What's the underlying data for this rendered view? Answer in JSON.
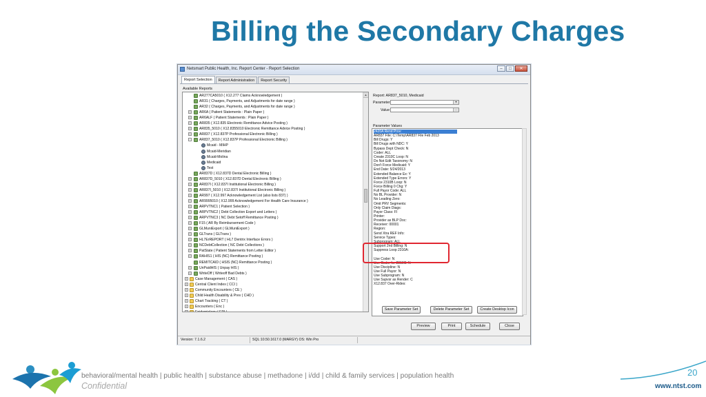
{
  "slide": {
    "title": "Billing the Secondary Charges",
    "tagline": "behavioral/mental health | public health | substance abuse | methadone | i/dd | child & family services | population health",
    "confidential": "Confidential",
    "page_number": "20",
    "url": "www.ntst.com"
  },
  "window": {
    "title": "Netsmart Public Health, Inc. Report Center - Report Selection",
    "controls": [
      "–",
      "□",
      "✕"
    ]
  },
  "tabs": [
    "Report Selection",
    "Report Administration",
    "Report Security"
  ],
  "available_reports_label": "Available Reports",
  "tree": [
    {
      "text": "AR277CA5010 ( X12.277 Claims Acknowledgement )",
      "level": 1,
      "icon": "report"
    },
    {
      "text": "AR31 ( Charges, Payments, and Adjustments for date range )",
      "level": 1,
      "icon": "report"
    },
    {
      "text": "AR32 ( Charges, Payments, and Adjustments for date range )",
      "level": 1,
      "icon": "report"
    },
    {
      "text": "AR6A ( Patient Statements : Plain Paper )",
      "level": 1,
      "icon": "report",
      "exp": "+"
    },
    {
      "text": "AR6ALF ( Patient Statements : Plain Paper )",
      "level": 1,
      "icon": "report",
      "exp": "+"
    },
    {
      "text": "AR835 ( X12.835 Electronic Remittance Advice Posting )",
      "level": 1,
      "icon": "report",
      "exp": "+"
    },
    {
      "text": "AR835_5010 ( X12.8355010 Electronic Remittance Advice Posting )",
      "level": 1,
      "icon": "report",
      "exp": "+"
    },
    {
      "text": "AR837 ( X12.837P Professional Electronic Billing )",
      "level": 1,
      "icon": "report",
      "exp": "+"
    },
    {
      "text": "AR837_5010 ( X12.837P Professional Electronic Billing )",
      "level": 1,
      "icon": "report",
      "exp": "-"
    },
    {
      "text": "Mcaid - MIHP",
      "level": 2,
      "icon": "user"
    },
    {
      "text": "Mcaid-Meridian",
      "level": 2,
      "icon": "user"
    },
    {
      "text": "Mcaid-Molina",
      "level": 2,
      "icon": "user"
    },
    {
      "text": "Medicaid",
      "level": 2,
      "icon": "user"
    },
    {
      "text": "Test",
      "level": 2,
      "icon": "user"
    },
    {
      "text": "AR837D ( X12.837D Dental Electronic Billing )",
      "level": 1,
      "icon": "report"
    },
    {
      "text": "AR837D_5010 ( X12.837D Dental Electronic Billing )",
      "level": 1,
      "icon": "report",
      "exp": "+"
    },
    {
      "text": "AR837I ( X12.837I Institutional Electronic Billing )",
      "level": 1,
      "icon": "report",
      "exp": "+"
    },
    {
      "text": "AR837I_5010 ( X12.837I Institutional Electronic Billing )",
      "level": 1,
      "icon": "report",
      "exp": "+"
    },
    {
      "text": "AR997 ( X12.997 Acknowledgement List (also lists 837) )",
      "level": 1,
      "icon": "report",
      "exp": "+"
    },
    {
      "text": "AR9995010 ( X12.999 Acknowledgement For Health Care Insurance )",
      "level": 1,
      "icon": "report",
      "exp": "+"
    },
    {
      "text": "ARPVTNC1 ( Patient Selection )",
      "level": 1,
      "icon": "report",
      "exp": "+"
    },
    {
      "text": "ARPVTNC2 ( Debt Collection Export and Letters )",
      "level": 1,
      "icon": "report",
      "exp": "+"
    },
    {
      "text": "ARPVTNC3 ( NC Debt Setoff Remittance Posting )",
      "level": 1,
      "icon": "report",
      "exp": "+"
    },
    {
      "text": "F15 ( AR By Reimbursement Code )",
      "level": 1,
      "icon": "report",
      "exp": "+"
    },
    {
      "text": "GLMuniExport ( GLMuniExport )",
      "level": 1,
      "icon": "report",
      "exp": "+"
    },
    {
      "text": "GLTrans ( GLTrans )",
      "level": 1,
      "icon": "report",
      "exp": "+"
    },
    {
      "text": "HL7ErREPORT ( HL7 Dentrix Interface Errors )",
      "level": 1,
      "icon": "report",
      "exp": "+"
    },
    {
      "text": "NCDebtCollection ( NC Debt Collections )",
      "level": 1,
      "icon": "report",
      "exp": "+"
    },
    {
      "text": "PatState ( Patient Statements from Letter Editor )",
      "level": 1,
      "icon": "report",
      "exp": "+"
    },
    {
      "text": "RAHIS1 ( HIS (NC) Remittance Posting )",
      "level": 1,
      "icon": "report",
      "exp": "+"
    },
    {
      "text": "REMITCAID ( HSIS (NC) Remittance Posting )",
      "level": 1,
      "icon": "report"
    },
    {
      "text": "UnPaidHIS ( Unpay HIS )",
      "level": 1,
      "icon": "report",
      "exp": "+"
    },
    {
      "text": "WriteOff ( Writeoff Bad Debts )",
      "level": 1,
      "icon": "report",
      "exp": "+"
    },
    {
      "text": "Case Management ( CAS )",
      "level": 0,
      "icon": "folder",
      "exp": "+"
    },
    {
      "text": "Central Client Index ( CCI )",
      "level": 0,
      "icon": "folder",
      "exp": "+"
    },
    {
      "text": "Community Encounters ( CE )",
      "level": 0,
      "icon": "folder",
      "exp": "+"
    },
    {
      "text": "Child Health Disability & Prev ( CHD )",
      "level": 0,
      "icon": "folder",
      "exp": "+"
    },
    {
      "text": "Chart Tracking ( CT )",
      "level": 0,
      "icon": "folder",
      "exp": "+"
    },
    {
      "text": "Encounters ( Enc )",
      "level": 0,
      "icon": "folder",
      "exp": "+"
    },
    {
      "text": "Epidemiology ( EPI )",
      "level": 0,
      "icon": "folder",
      "exp": "+"
    }
  ],
  "right_panel": {
    "report_label": "Report: AR837_5010, Medicaid",
    "parameter_label": "Parameter",
    "value_label": "Value",
    "parameter_values_label": "Parameter Values",
    "parameter_values": [
      "2420A Rend Prov:",
      "AR837 File: C:\\Temp\\AR837 File Feb 2013",
      "Bill Drugs: Y",
      "Bill Drugs with NDC: Y",
      "Bypass Dept Check: N",
      "Coder: ALL",
      "Create 2310C Loop: N",
      "Do Not Edit Taxonomy: N",
      "Don't Force Medicaid: Y",
      "End Date: 5/24/2013",
      "Extended Balance Ex: Y",
      "Extended Type Errors: Y",
      "Force 2310B Loop: N",
      "Force Billing 0 Chg: Y",
      "Full Payor Code: ALL",
      "No BL Provider: N",
      "No Leading Zero:",
      "Omit PRV Segments:",
      "Only Claim Diags:",
      "Payor Class: FI",
      "Printer:",
      "Provider as BLP Doc:",
      "Receiver: 00001",
      "Region:",
      "Send Xtra REF Info:",
      "Service Types:",
      "Subprogram: ALL",
      "Support 2nd Billing: N",
      "Suppress Loop 2310A:",
      "",
      "Use Coder: N",
      "Use Coder for 2310C: N",
      "Use Discipline: N",
      "Use Full Payor: N",
      "Use Subprogram: N",
      "Use Supvsr as Render: C",
      "X12.837 Over-Rides:"
    ],
    "buttons": [
      "Save Parameter Set",
      "Delete Parameter Set",
      "Create Desktop Icon"
    ]
  },
  "bottom_buttons": [
    "Preview",
    "Print",
    "Schedule",
    "Close"
  ],
  "status": {
    "version": "Version: 7.1.6.2",
    "sql": "SQL:10.50.1617.0 (MARGY) OS: Win Pro"
  }
}
